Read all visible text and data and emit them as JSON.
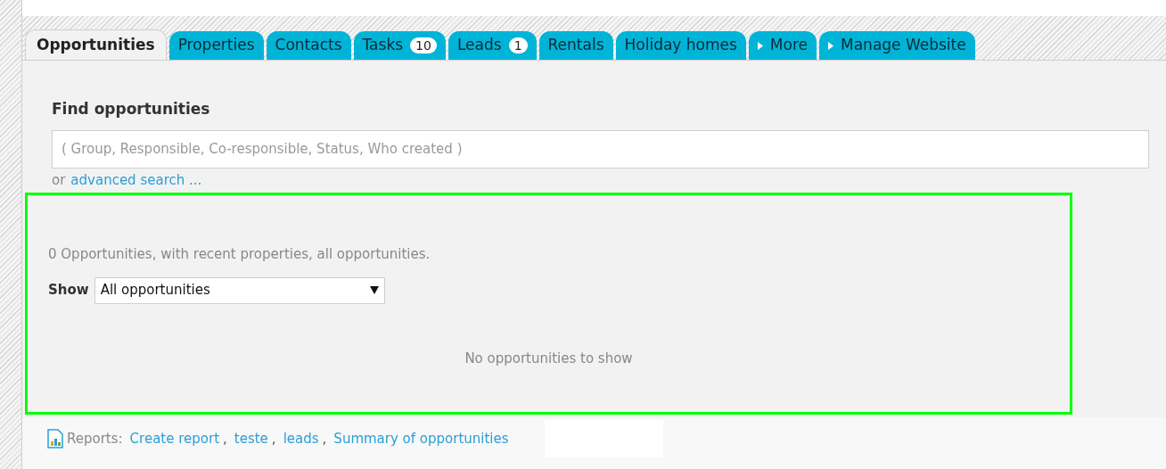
{
  "tabs": [
    {
      "label": "Opportunities",
      "selected": true,
      "kind": "plain"
    },
    {
      "label": "Properties",
      "selected": false,
      "kind": "plain"
    },
    {
      "label": "Contacts",
      "selected": false,
      "kind": "plain"
    },
    {
      "label": "Tasks",
      "selected": false,
      "kind": "plain",
      "badge": "10"
    },
    {
      "label": "Leads",
      "selected": false,
      "kind": "plain",
      "badge": "1"
    },
    {
      "label": "Rentals",
      "selected": false,
      "kind": "plain"
    },
    {
      "label": "Holiday homes",
      "selected": false,
      "kind": "plain"
    },
    {
      "label": "More",
      "selected": false,
      "kind": "menu"
    },
    {
      "label": "Manage Website",
      "selected": false,
      "kind": "menu"
    }
  ],
  "search": {
    "title": "Find opportunities",
    "placeholder": "( Group, Responsible, Co-responsible, Status, Who created )",
    "or_text": "or",
    "advanced_link": "advanced search ..."
  },
  "results": {
    "summary": "0 Opportunities, with recent properties, all opportunities.",
    "show_label": "Show",
    "show_value": "All opportunities",
    "empty_message": "No opportunities to show"
  },
  "reports": {
    "label": "Reports:",
    "links": [
      {
        "text": "Create report",
        "separator": ","
      },
      {
        "text": "teste",
        "separator": ","
      },
      {
        "text": "leads",
        "separator": ","
      },
      {
        "text": "Summary of opportunities"
      }
    ]
  }
}
